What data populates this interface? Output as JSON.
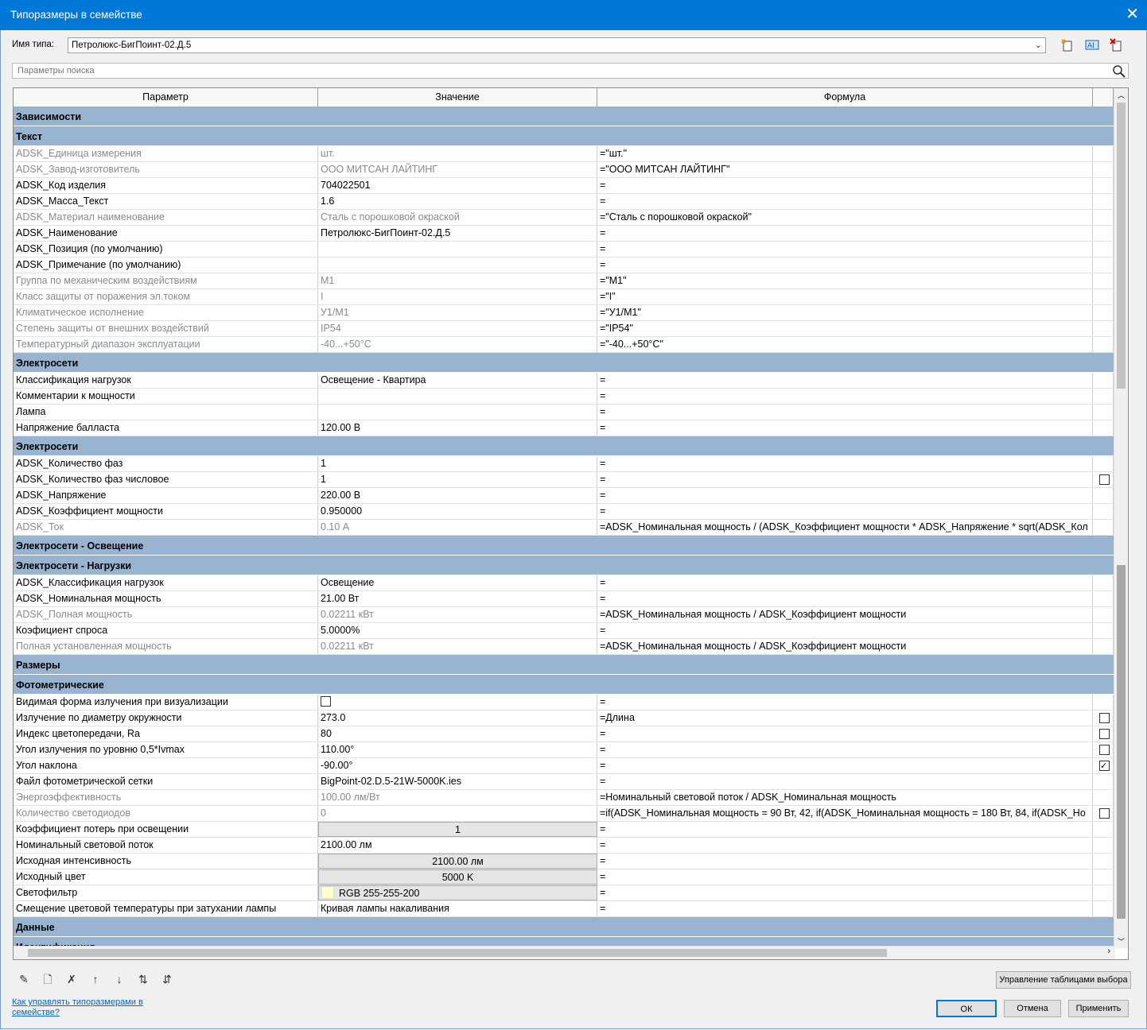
{
  "window": {
    "title": "Типоразмеры в семействе",
    "close": "✕"
  },
  "type_name": {
    "label": "Имя типа:",
    "value": "Петролюкс-БигПоинт-02.Д.5"
  },
  "search": {
    "placeholder": "Параметры поиска"
  },
  "columns": [
    "Параметр",
    "Значение",
    "Формула"
  ],
  "rows": [
    {
      "kind": "group",
      "label": "Зависимости"
    },
    {
      "kind": "group",
      "label": "Текст"
    },
    {
      "param": "ADSK_Единица измерения",
      "value": "шт.",
      "formula": "=\"шт.\"",
      "dim": true
    },
    {
      "param": "ADSK_Завод-изготовитель",
      "value": "ООО МИТСАН ЛАЙТИНГ",
      "formula": "=\"ООО МИТСАН ЛАЙТИНГ\"",
      "dim": true
    },
    {
      "param": "ADSK_Код изделия",
      "value": "704022501",
      "formula": "="
    },
    {
      "param": "ADSK_Масса_Текст",
      "value": "1.6",
      "formula": "="
    },
    {
      "param": "ADSK_Материал наименование",
      "value": "Сталь с порошковой окраской",
      "formula": "=\"Сталь с порошковой окраской\"",
      "dim": true
    },
    {
      "param": "ADSK_Наименование",
      "value": "Петролюкс-БигПоинт-02.Д.5",
      "formula": "="
    },
    {
      "param": "ADSK_Позиция (по умолчанию)",
      "value": "",
      "formula": "="
    },
    {
      "param": "ADSK_Примечание (по умолчанию)",
      "value": "",
      "formula": "="
    },
    {
      "param": "Группа по механическим воздействиям",
      "value": "М1",
      "formula": "=\"М1\"",
      "dim": true
    },
    {
      "param": "Класс защиты от поражения эл.током",
      "value": "I",
      "formula": "=\"I\"",
      "dim": true
    },
    {
      "param": "Климатическое исполнение",
      "value": "У1/М1",
      "formula": "=\"У1/М1\"",
      "dim": true
    },
    {
      "param": "Степень защиты от внешних воздействий",
      "value": "IP54",
      "formula": "=\"IP54\"",
      "dim": true
    },
    {
      "param": "Температурный диапазон эксплуатации",
      "value": "-40...+50°С",
      "formula": "=\"-40...+50°С\"",
      "dim": true
    },
    {
      "kind": "group",
      "label": "Электросети"
    },
    {
      "param": "Классификация нагрузок",
      "value": "Освещение - Квартира",
      "formula": "="
    },
    {
      "param": "Комментарии к мощности",
      "value": "",
      "formula": "="
    },
    {
      "param": "Лампа",
      "value": "",
      "formula": "="
    },
    {
      "param": "Напряжение балласта",
      "value": "120.00 В",
      "formula": "="
    },
    {
      "kind": "group",
      "label": "Электросети"
    },
    {
      "param": "ADSK_Количество фаз",
      "value": "1",
      "formula": "="
    },
    {
      "param": "ADSK_Количество фаз числовое",
      "value": "1",
      "formula": "=",
      "check": false
    },
    {
      "param": "ADSK_Напряжение",
      "value": "220.00 В",
      "formula": "="
    },
    {
      "param": "ADSK_Коэффициент мощности",
      "value": "0.950000",
      "formula": "="
    },
    {
      "param": "ADSK_Ток",
      "value": "0.10 А",
      "formula": "=ADSK_Номинальная мощность / (ADSK_Коэффициент мощности * ADSK_Напряжение * sqrt(ADSK_Кол",
      "dim": true
    },
    {
      "kind": "group",
      "label": "Электросети - Освещение"
    },
    {
      "kind": "group",
      "label": "Электросети - Нагрузки"
    },
    {
      "param": "ADSK_Классификация нагрузок",
      "value": "Освещение",
      "formula": "="
    },
    {
      "param": "ADSK_Номинальная мощность",
      "value": "21.00 Вт",
      "formula": "="
    },
    {
      "param": "ADSK_Полная мощность",
      "value": "0.02211 кВт",
      "formula": "=ADSK_Номинальная мощность / ADSK_Коэффициент мощности",
      "dim": true
    },
    {
      "param": "Коэфициент спроса",
      "value": "5.0000%",
      "formula": "="
    },
    {
      "param": "Полная установленная мощность",
      "value": "0.02211 кВт",
      "formula": "=ADSK_Номинальная мощность / ADSK_Коэффициент мощности",
      "dim": true
    },
    {
      "kind": "group",
      "label": "Размеры"
    },
    {
      "kind": "group",
      "label": "Фотометрические"
    },
    {
      "param": "Видимая форма излучения при визуализации",
      "valueCheck": false,
      "formula": "="
    },
    {
      "param": "Излучение по диаметру окружности",
      "value": "273.0",
      "formula": "=Длина",
      "check": false
    },
    {
      "param": "Индекс цветопередачи, Ra",
      "value": "80",
      "formula": "=",
      "check": false
    },
    {
      "param": "Угол излучения по уровню 0,5*Ivmax",
      "value": "110.00°",
      "formula": "=",
      "check": false
    },
    {
      "param": "Угол наклона",
      "value": "-90.00°",
      "formula": "=",
      "check": true
    },
    {
      "param": "Файл фотометрической сетки",
      "value": "BigPoint-02.D.5-21W-5000K.ies",
      "formula": "="
    },
    {
      "param": "Энергоэффективность",
      "value": "100.00 лм/Вт",
      "formula": "=Номинальный световой поток / ADSK_Номинальная мощность",
      "dim": true
    },
    {
      "param": "Количество светодиодов",
      "value": "0",
      "formula": "=if(ADSK_Номинальная мощность = 90 Вт, 42, if(ADSK_Номинальная мощность = 180 Вт, 84, if(ADSK_Но",
      "dim": true,
      "check": false
    },
    {
      "param": "Коэффициент потерь при освещении",
      "value": "1",
      "formula": "=",
      "button": true
    },
    {
      "param": "Номинальный световой поток",
      "value": "2100.00 лм",
      "formula": "="
    },
    {
      "param": "Исходная интенсивность",
      "value": "2100.00 лм",
      "formula": "=",
      "button": true
    },
    {
      "param": "Исходный цвет",
      "value": "5000 K",
      "formula": "=",
      "button": true
    },
    {
      "param": "Светофильтр",
      "value": "RGB 255-255-200",
      "formula": "=",
      "swatch": "#ffffc8",
      "button": true
    },
    {
      "param": "Смещение цветовой температуры при затухании лампы",
      "value": "Кривая лампы накаливания",
      "formula": "="
    },
    {
      "kind": "group",
      "label": "Данные"
    },
    {
      "kind": "group",
      "label": "Идентификация"
    }
  ],
  "bottom_toolbar": [
    "pencil-icon",
    "new-type-icon",
    "delete-type-icon",
    "move-up-icon",
    "move-down-icon",
    "sort-asc-icon",
    "sort-desc-icon"
  ],
  "buttons": {
    "manage_lookup": "Управление таблицами выбора",
    "help_link": "Как управлять типоразмерами в семействе?",
    "ok": "ОК",
    "cancel": "Отмена",
    "apply": "Применить"
  }
}
